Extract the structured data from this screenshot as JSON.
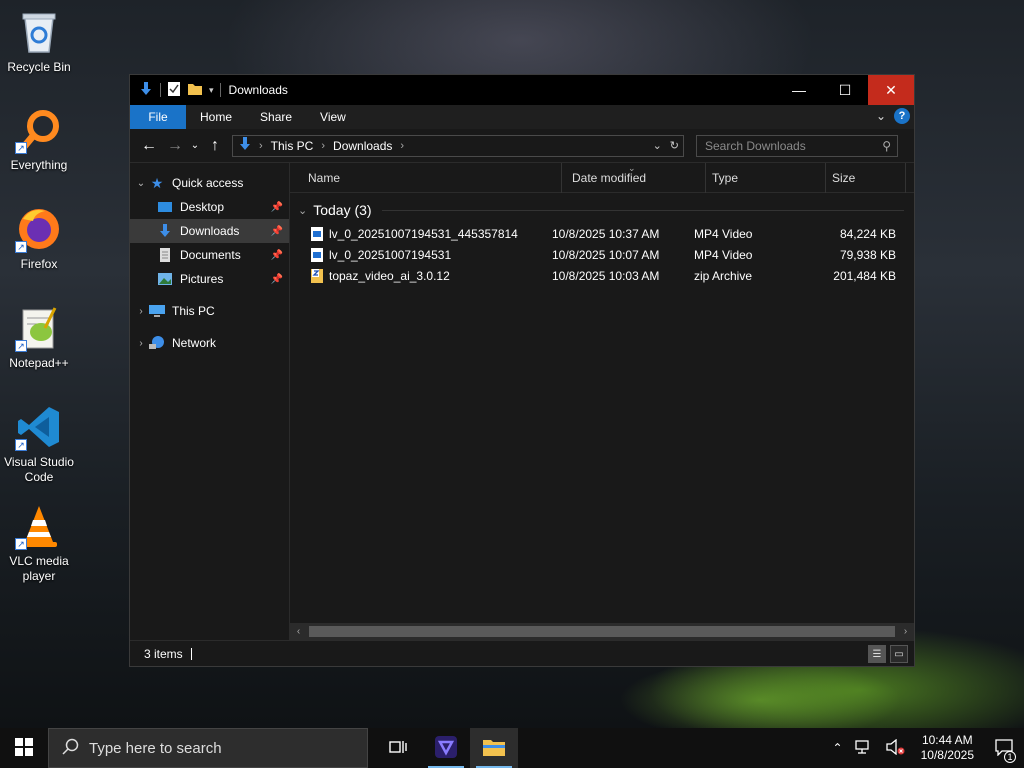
{
  "desktop": {
    "icons": [
      {
        "label": "Recycle Bin"
      },
      {
        "label": "Everything"
      },
      {
        "label": "Firefox"
      },
      {
        "label": "Notepad++"
      },
      {
        "label": "Visual Studio Code"
      },
      {
        "label": "VLC media player"
      }
    ]
  },
  "window": {
    "title": "Downloads",
    "ribbon_tabs": [
      "File",
      "Home",
      "Share",
      "View"
    ],
    "help_label": "?",
    "address": {
      "crumbs": [
        "This PC",
        "Downloads"
      ]
    },
    "search": {
      "placeholder": "Search Downloads"
    },
    "nav": {
      "quick_access": "Quick access",
      "items": [
        {
          "label": "Desktop",
          "pinned": true
        },
        {
          "label": "Downloads",
          "pinned": true,
          "selected": true
        },
        {
          "label": "Documents",
          "pinned": true
        },
        {
          "label": "Pictures",
          "pinned": true
        }
      ],
      "this_pc": "This PC",
      "network": "Network"
    },
    "columns": [
      "Name",
      "Date modified",
      "Type",
      "Size"
    ],
    "group": {
      "label": "Today (3)"
    },
    "files": [
      {
        "name": "lv_0_20251007194531_445357814",
        "date": "10/8/2025 10:37 AM",
        "type": "MP4 Video",
        "size": "84,224 KB",
        "icon": "video-file-icon"
      },
      {
        "name": "lv_0_20251007194531",
        "date": "10/8/2025 10:07 AM",
        "type": "MP4 Video",
        "size": "79,938 KB",
        "icon": "video-file-icon"
      },
      {
        "name": "topaz_video_ai_3.0.12",
        "date": "10/8/2025 10:03 AM",
        "type": "zip Archive",
        "size": "201,484 KB",
        "icon": "zip-file-icon"
      }
    ],
    "status": {
      "items_count": "3 items"
    }
  },
  "taskbar": {
    "search_placeholder": "Type here to search",
    "clock": {
      "time": "10:44 AM",
      "date": "10/8/2025"
    },
    "notification_count": "1"
  },
  "colors": {
    "accent": "#1a73c8",
    "close_red": "#c42b1c",
    "folder_yellow": "#f2c14e",
    "download_blue": "#3d8ee8"
  }
}
